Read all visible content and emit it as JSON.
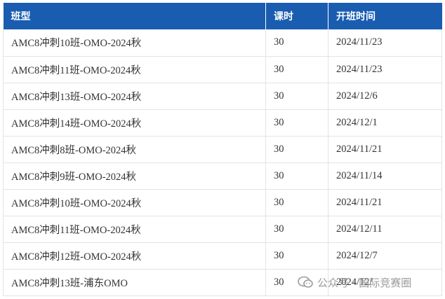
{
  "table": {
    "headers": [
      "班型",
      "课时",
      "开班时间"
    ],
    "rows": [
      [
        "AMC8冲刺10班-OMO-2024秋",
        "30",
        "2024/11/23"
      ],
      [
        "AMC8冲刺11班-OMO-2024秋",
        "30",
        "2024/11/23"
      ],
      [
        "AMC8冲刺13班-OMO-2024秋",
        "30",
        "2024/12/6"
      ],
      [
        "AMC8冲刺14班-OMO-2024秋",
        "30",
        "2024/12/1"
      ],
      [
        "AMC8冲刺8班-OMO-2024秋",
        "30",
        "2024/11/21"
      ],
      [
        "AMC8冲刺9班-OMO-2024秋",
        "30",
        "2024/11/14"
      ],
      [
        "AMC8冲刺10班-OMO-2024秋",
        "30",
        "2024/11/21"
      ],
      [
        "AMC8冲刺11班-OMO-2024秋",
        "30",
        "2024/12/11"
      ],
      [
        "AMC8冲刺12班-OMO-2024秋",
        "30",
        "2024/12/7"
      ],
      [
        "AMC8冲刺13班-浦东OMO",
        "30",
        "2024/12/"
      ]
    ]
  },
  "watermark": {
    "text": "公众号 · 国际竞赛圈",
    "icon": "wechat-official-account-icon"
  },
  "colors": {
    "header_bg": "#1a5db0",
    "header_text": "#ffffff",
    "border": "#e3e3e3"
  }
}
